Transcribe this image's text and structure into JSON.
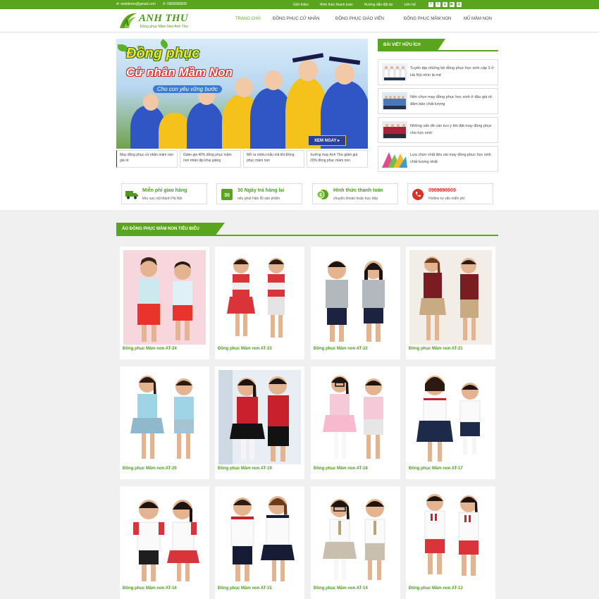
{
  "topbar": {
    "email": "webdemo@gmail.com",
    "phone": "0909090909",
    "links": [
      "Giới thiệu",
      "Hình thức thanh toán",
      "Hướng dẫn đặt áo",
      "Liên hệ"
    ],
    "socials": [
      "facebook-icon",
      "twitter-icon",
      "google-plus-icon",
      "youtube-icon",
      "instagram-icon"
    ]
  },
  "logo": {
    "name": "ANH THU",
    "tagline": "Đồng phục Mầm Non Anh Thư"
  },
  "nav": {
    "items": [
      "TRANG CHỦ",
      "ĐỒNG PHỤC CỬ NHÂN",
      "ĐỒNG PHỤC GIÁO VIÊN",
      "ĐỒNG PHỤC MẦM NON",
      "MŨ MẦM NON"
    ]
  },
  "banner": {
    "title_line1": "Đồng phục",
    "title_line2": "Cử nhân Mầm Non",
    "subtitle": "Cho con yêu vững bước",
    "cta": "XEM NGAY ▸"
  },
  "captions": [
    "May đồng phục cử nhân mầm non giá rẻ",
    "Giảm giá 40% đồng phục mầm non nhân dịp khai giảng",
    "Mở ra nhiều mẫu mã khi Đồng phục mầm non",
    "Xưởng may Anh Thư giảm giá 20% đồng phục mầm non"
  ],
  "sidebar": {
    "heading": "BÀI VIẾT HỮU ÍCH",
    "posts": [
      "Tuyển tập những bộ đồng phục học sinh cấp 3 ở Hà Nội nhìn là mê",
      "Nên chọn may đồng phục học sinh ở đâu giá rẻ, đảm bảo chất lượng",
      "Những vấn đề cần lưu ý khi đặt may đồng phục cho học sinh",
      "Lựa chọn chất liệu vải may đồng phục học sinh chất lượng nhất"
    ]
  },
  "features": [
    {
      "title": "Miễn phí giao hàng",
      "sub": "khu vực nội thành Hà Nội",
      "icon": "truck-icon"
    },
    {
      "title": "30 Ngày trả hàng lại",
      "sub": "nếu phát hiện lỗi sản phẩm",
      "icon": "return-30-icon"
    },
    {
      "title": "Hình thức thanh toán",
      "sub": "chuyển khoản hoặc trực tiếp",
      "icon": "money-icon"
    },
    {
      "title": "0909090909",
      "sub": "Hotline tư vấn miễn phí",
      "icon": "phone-icon"
    }
  ],
  "products": {
    "heading": "ÁO ĐỒNG PHỤC MẦM NON TIÊU BIỂU",
    "items": [
      "Đồng phục Mầm non AT-24",
      "Đồng phục Mầm non AT-23",
      "Đồng phục Mầm non AT-22",
      "Đồng phục Mầm non AT-21",
      "Đồng phục Mầm non AT-20",
      "Đồng phục Mầm non AT-19",
      "Đồng phục Mầm non AT-18",
      "Đồng phục Mầm non AT-17",
      "Đồng phục Mầm non AT-16",
      "Đồng phục Mầm non AT-15",
      "Đồng phục Mầm non AT-14",
      "Đồng phục Mầm non AT-13"
    ]
  },
  "colors": {
    "brand_green": "#5aa51e",
    "text_green": "#4c9a1f",
    "section_bg": "#f0f0f0"
  }
}
